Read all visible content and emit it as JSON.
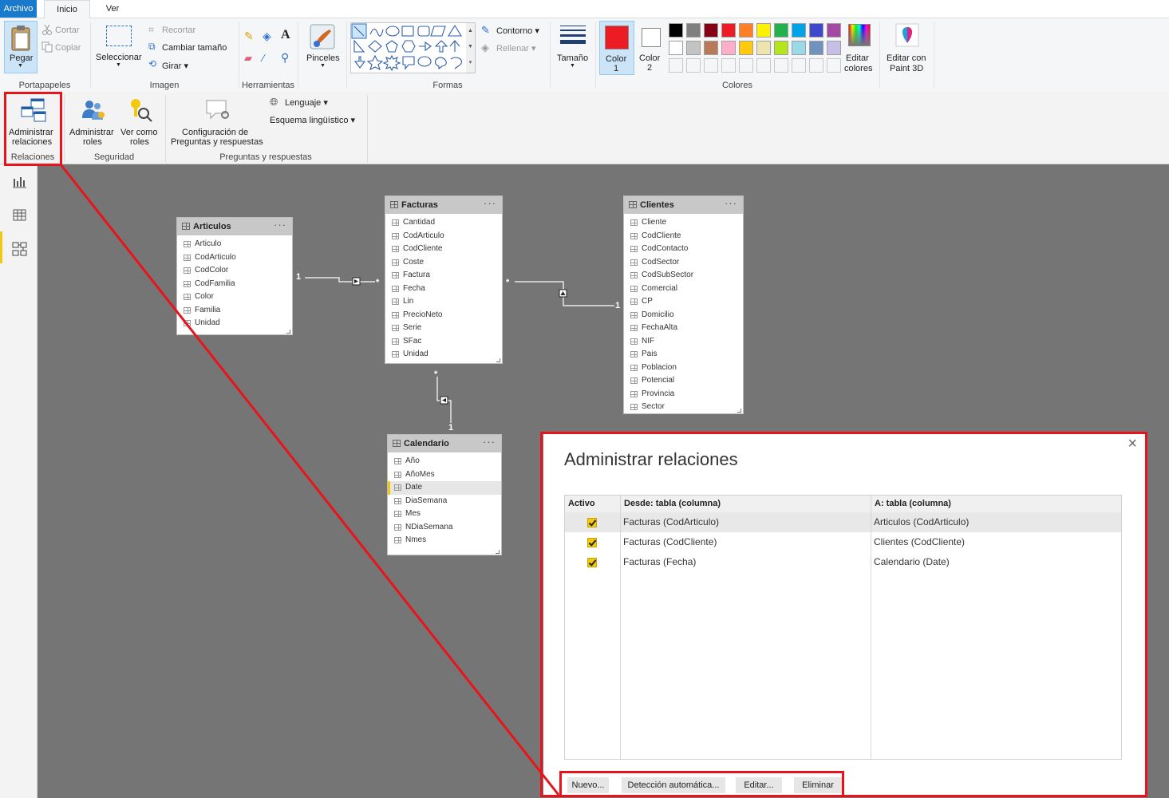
{
  "paint": {
    "tabs": [
      "Archivo",
      "Inicio",
      "Ver"
    ],
    "clipboard": {
      "paste": "Pegar",
      "cut": "Cortar",
      "copy": "Copiar",
      "group": "Portapapeles"
    },
    "image": {
      "select": "Seleccionar",
      "crop": "Recortar",
      "resize": "Cambiar tamaño",
      "rotate": "Girar",
      "group": "Imagen"
    },
    "tools": {
      "group": "Herramientas"
    },
    "brushes": {
      "label": "Pinceles"
    },
    "shapes": {
      "outline": "Contorno",
      "fill": "Rellenar",
      "group": "Formas"
    },
    "size": {
      "label": "Tamaño"
    },
    "colors": {
      "color1": "Color",
      "color1_num": "1",
      "color2": "Color",
      "color2_num": "2",
      "edit": "Editar",
      "edit2": "colores",
      "paint3d": "Editar con",
      "paint3d2": "Paint 3D",
      "group": "Colores",
      "color1_value": "#ed1c24",
      "color2_value": "#ffffff",
      "palette_row1": [
        "#000000",
        "#7f7f7f",
        "#880015",
        "#ed1c24",
        "#ff7f27",
        "#fff200",
        "#22b14c",
        "#00a2e8",
        "#3f48cc",
        "#a349a4"
      ],
      "palette_row2": [
        "#ffffff",
        "#c3c3c3",
        "#b97a57",
        "#ffaec9",
        "#ffc90e",
        "#efe4b0",
        "#b5e61d",
        "#99d9ea",
        "#7092be",
        "#c8bfe7"
      ]
    }
  },
  "pbi": {
    "manage_rel": {
      "l1": "Administrar",
      "l2": "relaciones",
      "group": "Relaciones"
    },
    "manage_roles": {
      "l1": "Administrar",
      "l2": "roles"
    },
    "view_roles": {
      "l1": "Ver como",
      "l2": "roles"
    },
    "security_group": "Seguridad",
    "qa_config": {
      "l1": "Configuración de",
      "l2": "Preguntas y respuestas"
    },
    "language": "Lenguaje",
    "schema": "Esquema lingüístico",
    "qa_group": "Preguntas y respuestas"
  },
  "tables": [
    {
      "name": "Articulos",
      "columns": [
        "Articulo",
        "CodArticulo",
        "CodColor",
        "CodFamilia",
        "Color",
        "Familia",
        "Unidad"
      ]
    },
    {
      "name": "Facturas",
      "columns": [
        "Cantidad",
        "CodArticulo",
        "CodCliente",
        "Coste",
        "Factura",
        "Fecha",
        "Lin",
        "PrecioNeto",
        "Serie",
        "SFac",
        "Unidad"
      ]
    },
    {
      "name": "Clientes",
      "columns": [
        "Cliente",
        "CodCliente",
        "CodContacto",
        "CodSector",
        "CodSubSector",
        "Comercial",
        "CP",
        "Domicilio",
        "FechaAlta",
        "NIF",
        "Pais",
        "Poblacion",
        "Potencial",
        "Provincia",
        "Sector"
      ]
    },
    {
      "name": "Calendario",
      "columns": [
        "Año",
        "AñoMes",
        "Date",
        "DiaSemana",
        "Mes",
        "NDiaSemana",
        "Nmes"
      ]
    }
  ],
  "relation_labels": {
    "one": "1",
    "many": "*"
  },
  "dialog": {
    "title": "Administrar relaciones",
    "headers": {
      "active": "Activo",
      "from": "Desde: tabla (columna)",
      "to": "A: tabla (columna)"
    },
    "rows": [
      {
        "from": "Facturas (CodArticulo)",
        "to": "Articulos (CodArticulo)",
        "active": true
      },
      {
        "from": "Facturas (CodCliente)",
        "to": "Clientes (CodCliente)",
        "active": true
      },
      {
        "from": "Facturas (Fecha)",
        "to": "Calendario (Date)",
        "active": true
      }
    ],
    "buttons": {
      "new": "Nuevo...",
      "autodetect": "Detección automática...",
      "edit": "Editar...",
      "delete": "Eliminar"
    },
    "close": "×"
  }
}
